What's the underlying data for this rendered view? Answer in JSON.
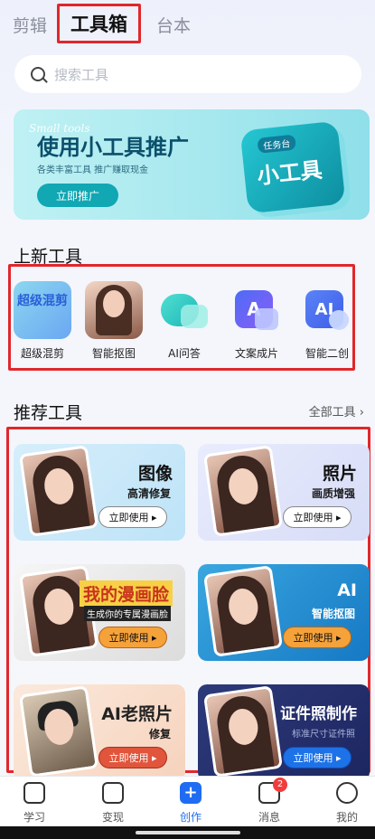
{
  "top_tabs": [
    "剪辑",
    "工具箱",
    "台本"
  ],
  "search": {
    "placeholder": "搜索工具"
  },
  "banner": {
    "small_text": "Small tools",
    "title": "使用小工具推广",
    "subtitle": "各类丰富工具 推广赚取现金",
    "button": "立即推广",
    "box_tag": "任务台",
    "box_text": "小工具"
  },
  "new_tools": {
    "title": "上新工具",
    "items": [
      {
        "label": "超级混剪",
        "icon": "super-mix-icon",
        "icon_text": "超级混剪"
      },
      {
        "label": "智能抠图",
        "icon": "portrait-cutout-icon"
      },
      {
        "label": "AI问答",
        "icon": "chat-bubble-icon"
      },
      {
        "label": "文案成片",
        "icon": "letter-a-play-icon",
        "icon_text": "A"
      },
      {
        "label": "智能二创",
        "icon": "ai-badge-icon",
        "icon_text": "AI"
      }
    ]
  },
  "recommended": {
    "title": "推荐工具",
    "all_link": "全部工具 ›",
    "cards": [
      {
        "title": "图像",
        "subtitle": "高清修复",
        "button": "立即使用 ▸"
      },
      {
        "title": "照片",
        "subtitle": "画质增强",
        "button": "立即使用 ▸"
      },
      {
        "title": "我的漫画脸",
        "subtitle": "生成你的专属漫画脸",
        "button": "立即使用 ▸"
      },
      {
        "title": "AI",
        "subtitle": "智能抠图",
        "button": "立即使用 ▸"
      },
      {
        "title": "AI老照片",
        "subtitle": "修复",
        "button": "立即使用 ▸"
      },
      {
        "title": "证件照制作",
        "subtitle": "标准尺寸证件照",
        "button": "立即使用 ▸"
      }
    ]
  },
  "bottom_nav": [
    {
      "label": "学习",
      "icon": "book-icon"
    },
    {
      "label": "变现",
      "icon": "coin-icon"
    },
    {
      "label": "创作",
      "icon": "plus-icon",
      "active": true
    },
    {
      "label": "消息",
      "icon": "message-icon",
      "badge": "2"
    },
    {
      "label": "我的",
      "icon": "profile-icon"
    }
  ],
  "colors": {
    "accent": "#1f6cf3",
    "highlight_frame": "#e0272b"
  }
}
